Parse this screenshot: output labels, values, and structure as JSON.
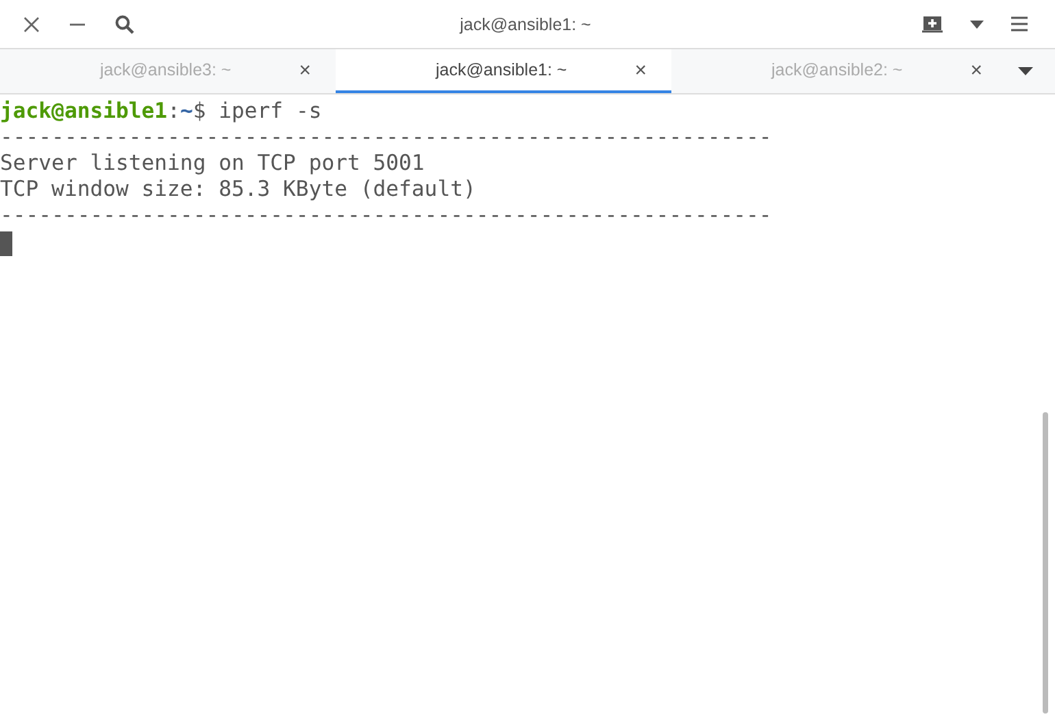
{
  "window": {
    "title": "jack@ansible1: ~"
  },
  "tabs": [
    {
      "label": "jack@ansible3: ~",
      "close": "×",
      "selected": false
    },
    {
      "label": "jack@ansible1: ~",
      "close": "×",
      "selected": true
    },
    {
      "label": "jack@ansible2: ~",
      "close": "×",
      "selected": false
    }
  ],
  "terminal": {
    "lines": [
      {
        "kind": "prompt",
        "user": "jack@ansible1",
        "sep": ":",
        "path": "~",
        "symbol": "$",
        "command": " iperf -s"
      },
      {
        "kind": "output",
        "text": "------------------------------------------------------------"
      },
      {
        "kind": "output",
        "text": "Server listening on TCP port 5001"
      },
      {
        "kind": "output",
        "text": "TCP window size: 85.3 KByte (default)"
      },
      {
        "kind": "output",
        "text": "------------------------------------------------------------"
      },
      {
        "kind": "cursor"
      }
    ]
  }
}
